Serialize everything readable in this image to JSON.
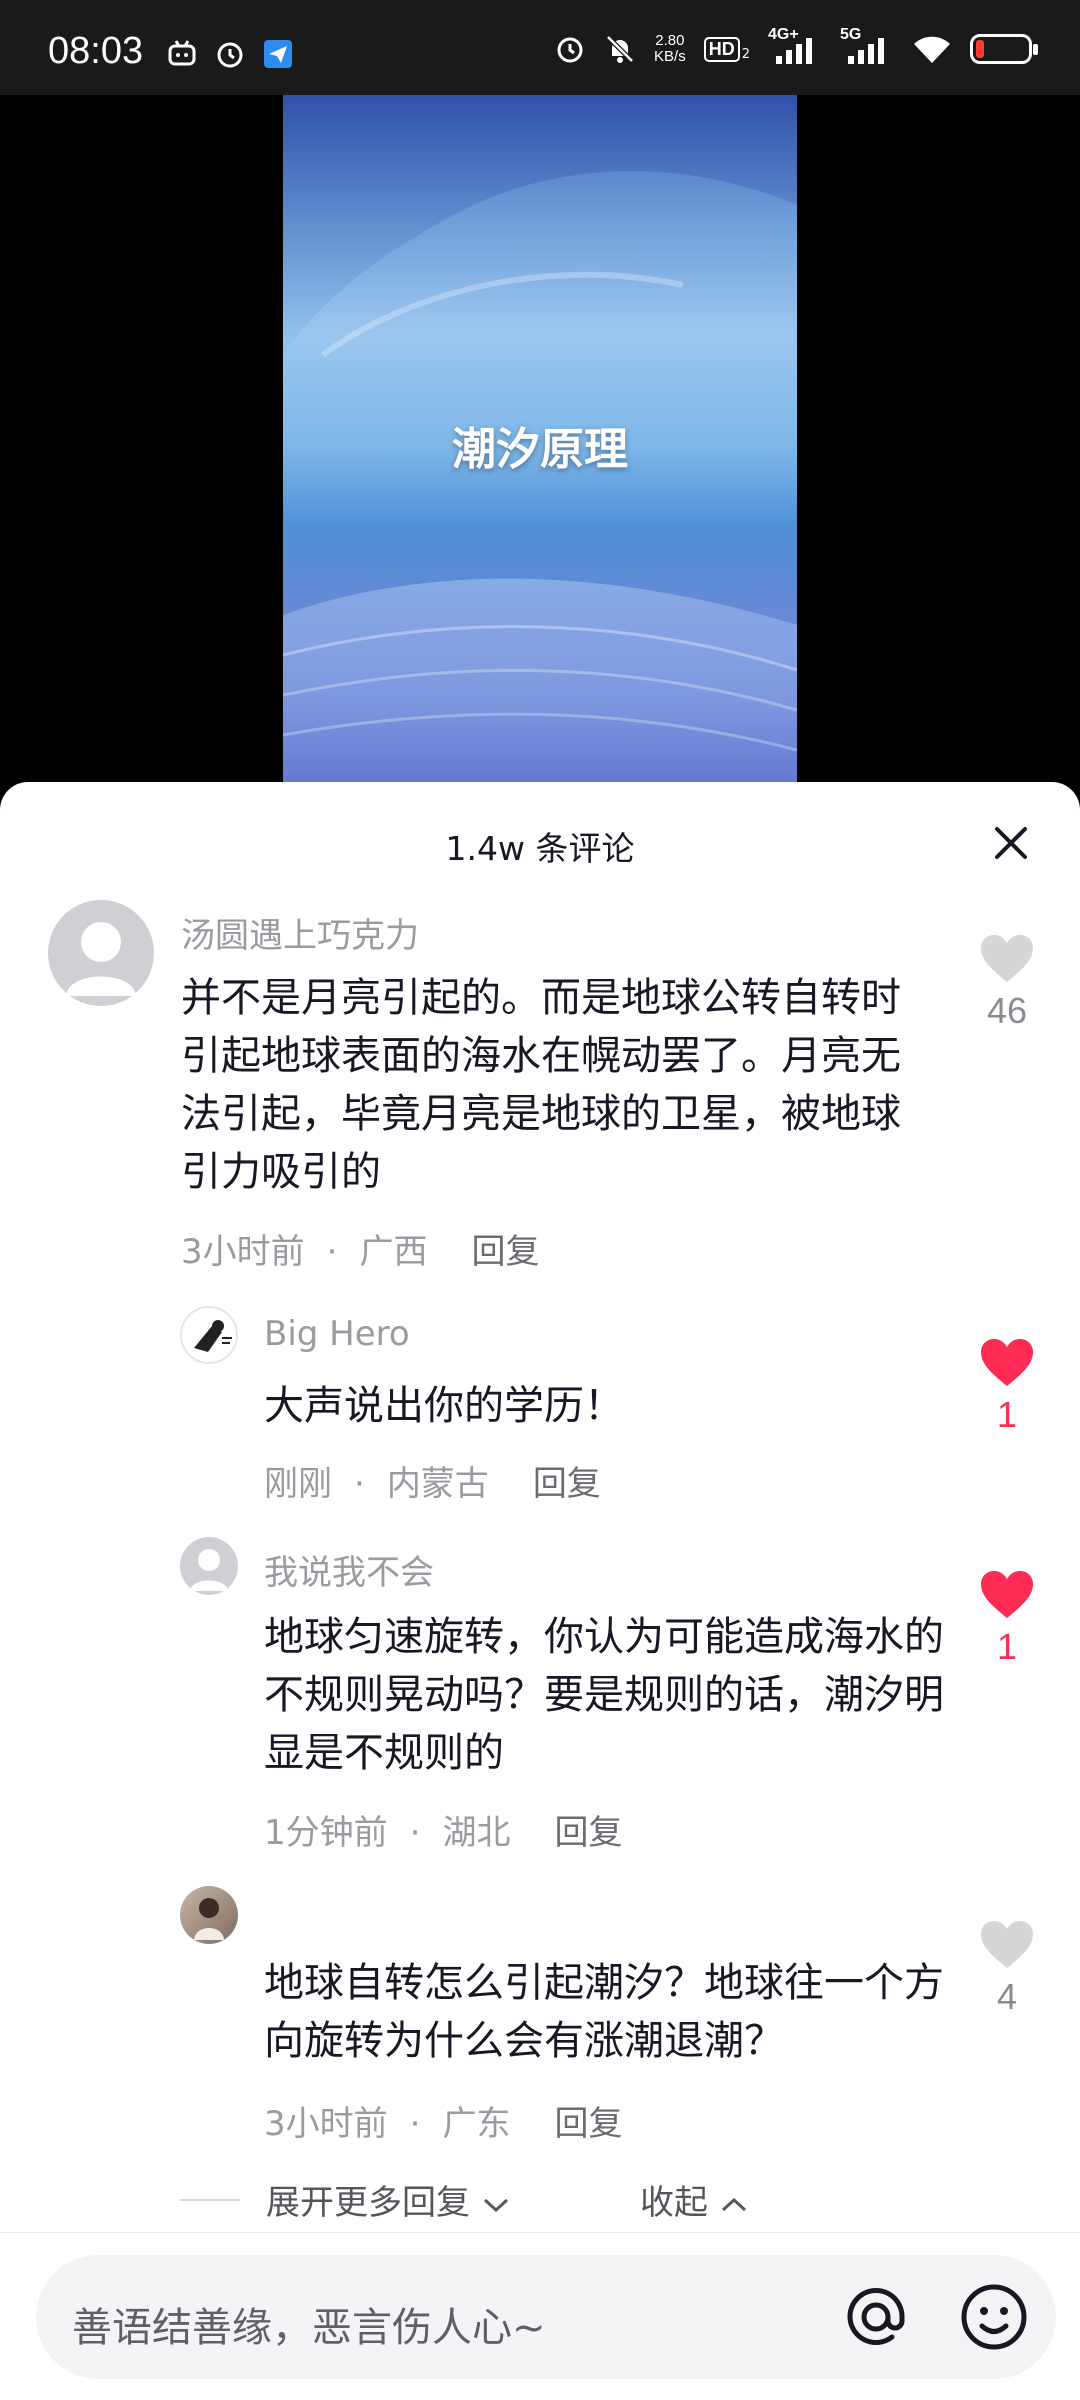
{
  "status_bar": {
    "time": "08:03",
    "net_speed_value": "2.80",
    "net_speed_unit": "KB/s",
    "hd_label": "HD",
    "hd_sub": "2",
    "net_4g": "4G+",
    "net_5g": "5G",
    "battery_level": 0.15,
    "icons": [
      "bilibili-icon",
      "alarm-icon",
      "send-app-icon",
      "alarm-icon",
      "mute-bell-icon",
      "signal-icon",
      "wifi-icon",
      "battery-icon"
    ]
  },
  "video": {
    "title": "潮汐原理"
  },
  "comments_header": {
    "title": "1.4w 条评论"
  },
  "comments": [
    {
      "username": "汤圆遇上巧克力",
      "text": "并不是月亮引起的。而是地球公转自转时引起地球表面的海水在幌动罢了。月亮无法引起，毕竟月亮是地球的卫星，被地球引力吸引的",
      "time": "3小时前",
      "location": "广西",
      "reply_label": "回复",
      "likes": "46",
      "liked": false
    },
    {
      "username": "Big Hero",
      "text": "大声说出你的学历！",
      "time": "刚刚",
      "location": "内蒙古",
      "reply_label": "回复",
      "likes": "1",
      "liked": true
    },
    {
      "username": "我说我不会",
      "text": "地球匀速旋转，你认为可能造成海水的不规则晃动吗？要是规则的话，潮汐明显是不规则的",
      "time": "1分钟前",
      "location": "湖北",
      "reply_label": "回复",
      "likes": "1",
      "liked": true
    },
    {
      "username": "",
      "text": "地球自转怎么引起潮汐？地球往一个方向旋转为什么会有涨潮退潮？",
      "time": "3小时前",
      "location": "广东",
      "reply_label": "回复",
      "likes": "4",
      "liked": false
    }
  ],
  "expand": {
    "more_label": "展开更多回复",
    "collapse_label": "收起"
  },
  "input": {
    "placeholder": "善语结善缘，恶言伤人心~"
  },
  "colors": {
    "like_active": "#fe2c55",
    "text_primary": "#161823",
    "text_secondary": "#9a9ba0"
  }
}
